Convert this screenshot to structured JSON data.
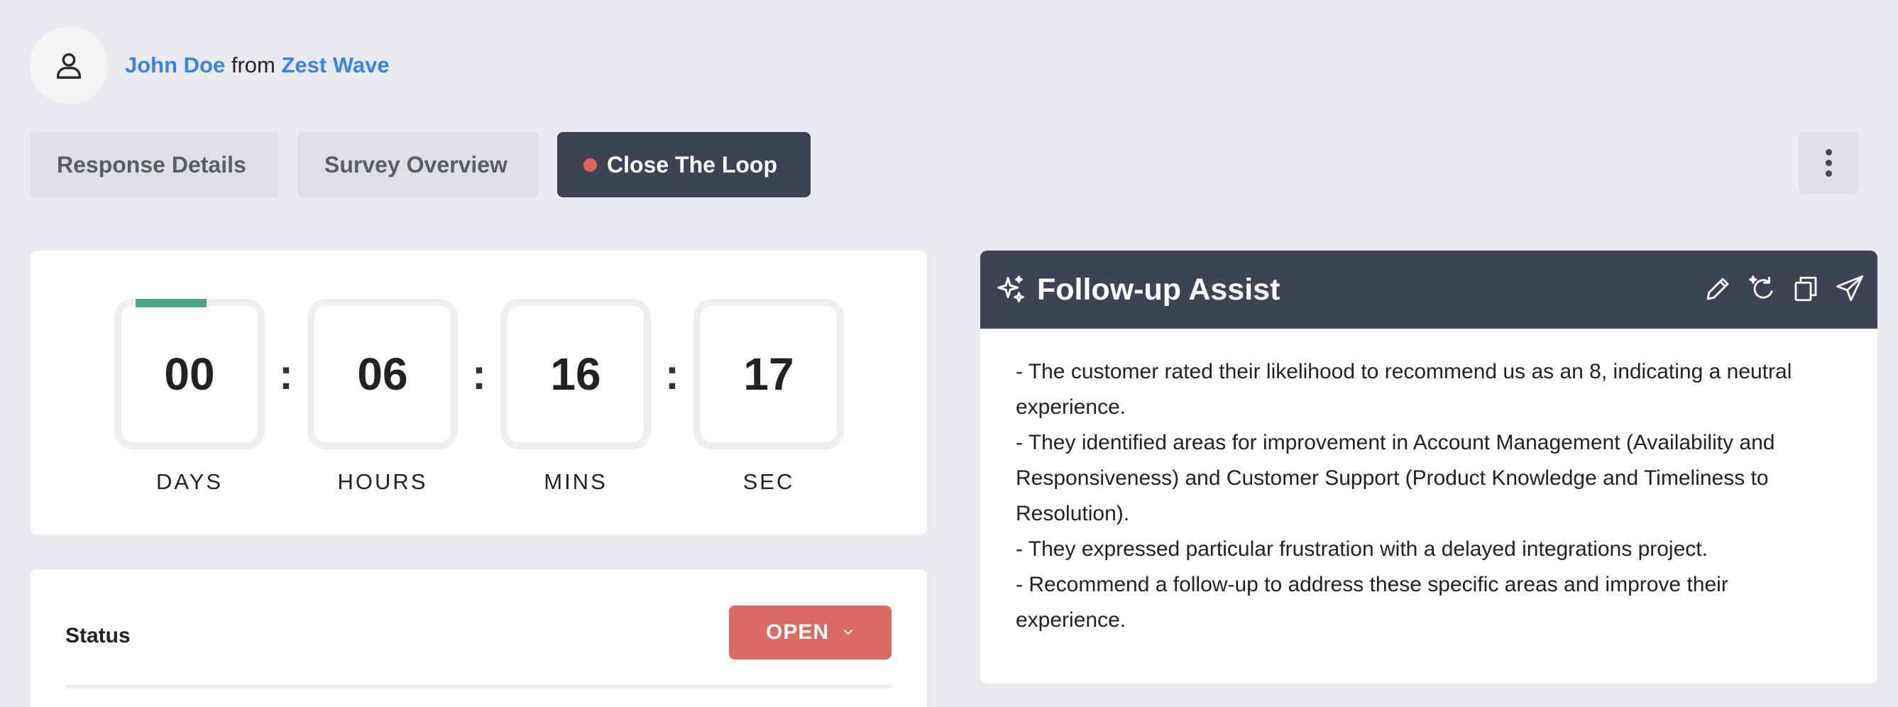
{
  "header": {
    "name": "John Doe",
    "connector": "from",
    "company": "Zest Wave"
  },
  "tabs": [
    {
      "label": "Response Details"
    },
    {
      "label": "Survey Overview"
    },
    {
      "label": "Close The Loop"
    }
  ],
  "countdown": {
    "units": [
      {
        "value": "00",
        "label": "DAYS"
      },
      {
        "value": "06",
        "label": "HOURS"
      },
      {
        "value": "16",
        "label": "MINS"
      },
      {
        "value": "17",
        "label": "SEC"
      }
    ],
    "separator": ":",
    "progress_color": "#4aa383"
  },
  "status": {
    "label": "Status",
    "value": "OPEN",
    "color": "#dc6a62"
  },
  "assist": {
    "title": "Follow-up Assist",
    "lines": [
      "- The customer rated their likelihood to recommend us as an 8, indicating a neutral experience.",
      "- They identified areas for improvement in Account Management (Availability and Responsiveness) and Customer Support (Product Knowledge and Timeliness to Resolution).",
      "- They expressed particular frustration with a delayed integrations project.",
      "- Recommend a follow-up to address these specific areas and improve their experience."
    ],
    "tools": [
      "pencil-icon",
      "regenerate-icon",
      "copy-icon",
      "send-icon"
    ]
  },
  "colors": {
    "accent_link": "#3b82e6",
    "dark": "#3d4350",
    "alert_dot": "#e0615a"
  }
}
